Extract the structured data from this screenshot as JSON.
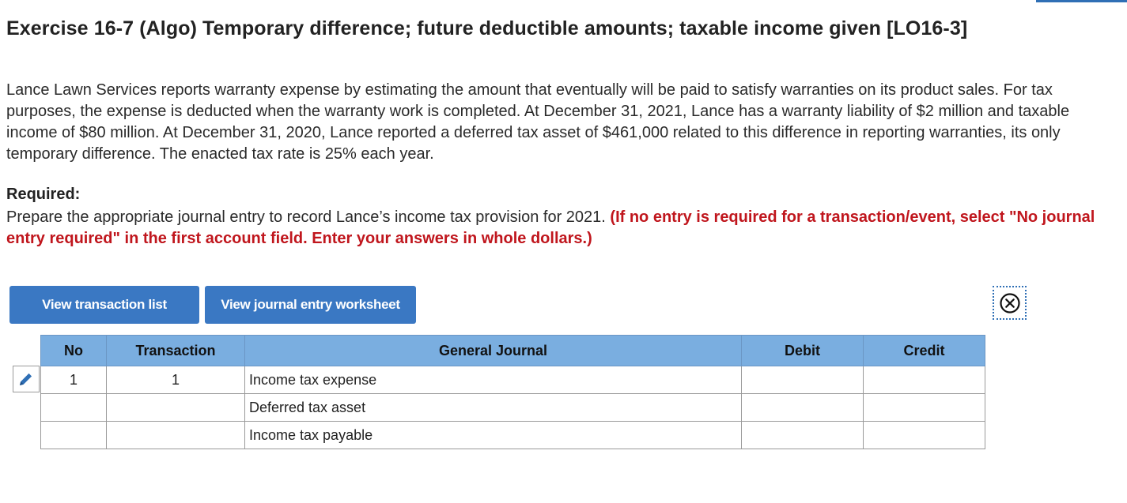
{
  "title": "Exercise 16-7 (Algo) Temporary difference; future deductible amounts; taxable income given [LO16-3]",
  "problem_text": "Lance Lawn Services reports warranty expense by estimating the amount that eventually will be paid to satisfy warranties on its product sales. For tax purposes, the expense is deducted when the warranty work is completed. At December 31, 2021, Lance has a warranty liability of $2 million and taxable income of $80 million. At December 31, 2020, Lance reported a deferred tax asset of $461,000 related to this difference in reporting warranties, its only temporary difference. The enacted tax rate is 25% each year.",
  "required_heading": "Required:",
  "instructions_text": "Prepare the appropriate journal entry to record Lance’s income tax provision for 2021.",
  "instructions_red": "(If no entry is required for a transaction/event, select \"No journal entry required\" in the first account field. Enter your answers in whole dollars.)",
  "buttons": {
    "transaction_list": "View transaction list",
    "journal_worksheet": "View journal entry worksheet"
  },
  "table": {
    "headers": {
      "no": "No",
      "transaction": "Transaction",
      "general_journal": "General Journal",
      "debit": "Debit",
      "credit": "Credit"
    },
    "rows": [
      {
        "no": "1",
        "transaction": "1",
        "account": "Income tax expense",
        "debit": "",
        "credit": ""
      },
      {
        "no": "",
        "transaction": "",
        "account": "Deferred tax asset",
        "debit": "",
        "credit": ""
      },
      {
        "no": "",
        "transaction": "",
        "account": "Income tax payable",
        "debit": "",
        "credit": ""
      }
    ]
  },
  "icons": {
    "close": "close-circle-icon",
    "edit": "pencil-icon"
  },
  "colors": {
    "button_bg": "#3a78c3",
    "header_bg": "#7aaee0",
    "instruction_red": "#c0161d"
  }
}
